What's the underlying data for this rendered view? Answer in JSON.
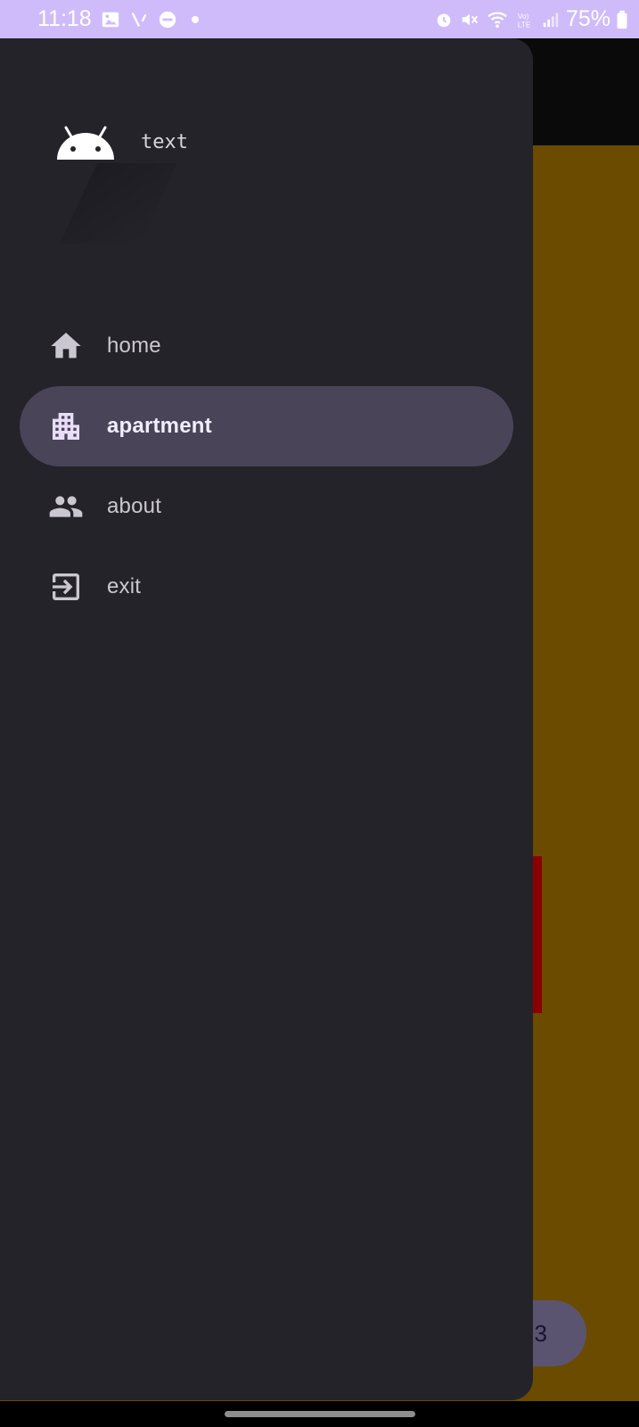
{
  "status_bar": {
    "time": "11:18",
    "battery": "75%",
    "icons": [
      "image-icon",
      "signal-slash-icon",
      "dnd-icon",
      "dot-icon",
      "alarm-icon",
      "mute-icon",
      "wifi-icon",
      "volte-icon",
      "cell-signal-icon",
      "battery-icon"
    ]
  },
  "drawer": {
    "header": {
      "text": "text",
      "logo": "android-logo-icon"
    },
    "items": [
      {
        "label": "home",
        "icon": "home-icon",
        "active": false
      },
      {
        "label": "apartment",
        "icon": "apartment-icon",
        "active": true
      },
      {
        "label": "about",
        "icon": "people-icon",
        "active": false
      },
      {
        "label": "exit",
        "icon": "exit-icon",
        "active": false
      }
    ]
  },
  "background_app": {
    "fab_label": "3"
  },
  "colors": {
    "status_bar_bg": "#cfbbfa",
    "drawer_bg": "#24232a",
    "active_item_bg": "#4a4459",
    "content_bg": "#6b4b00",
    "red_block": "#8a0000"
  }
}
